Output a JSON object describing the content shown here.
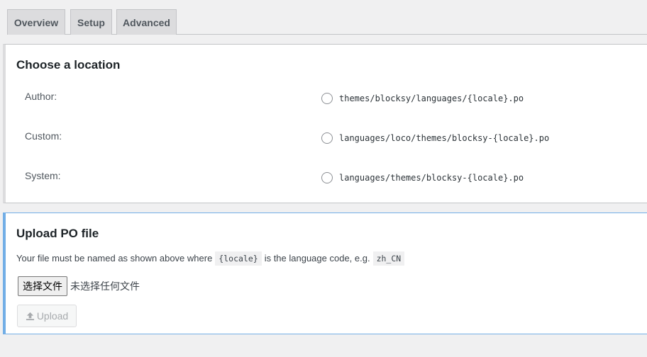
{
  "tabs": [
    "Overview",
    "Setup",
    "Advanced"
  ],
  "location": {
    "title": "Choose a location",
    "options": [
      {
        "label": "Author:",
        "path": "themes/blocksy/languages/{locale}.po"
      },
      {
        "label": "Custom:",
        "path": "languages/loco/themes/blocksy-{locale}.po"
      },
      {
        "label": "System:",
        "path": "languages/themes/blocksy-{locale}.po"
      }
    ]
  },
  "upload": {
    "title": "Upload PO file",
    "note_pre": "Your file must be named as shown above where",
    "note_code1": "{locale}",
    "note_mid": "is the language code, e.g.",
    "note_code2": "zh_CN",
    "choose_button": "选择文件",
    "no_file": "未选择任何文件",
    "upload_button": "Upload",
    "upload_icon": "upload-icon"
  }
}
